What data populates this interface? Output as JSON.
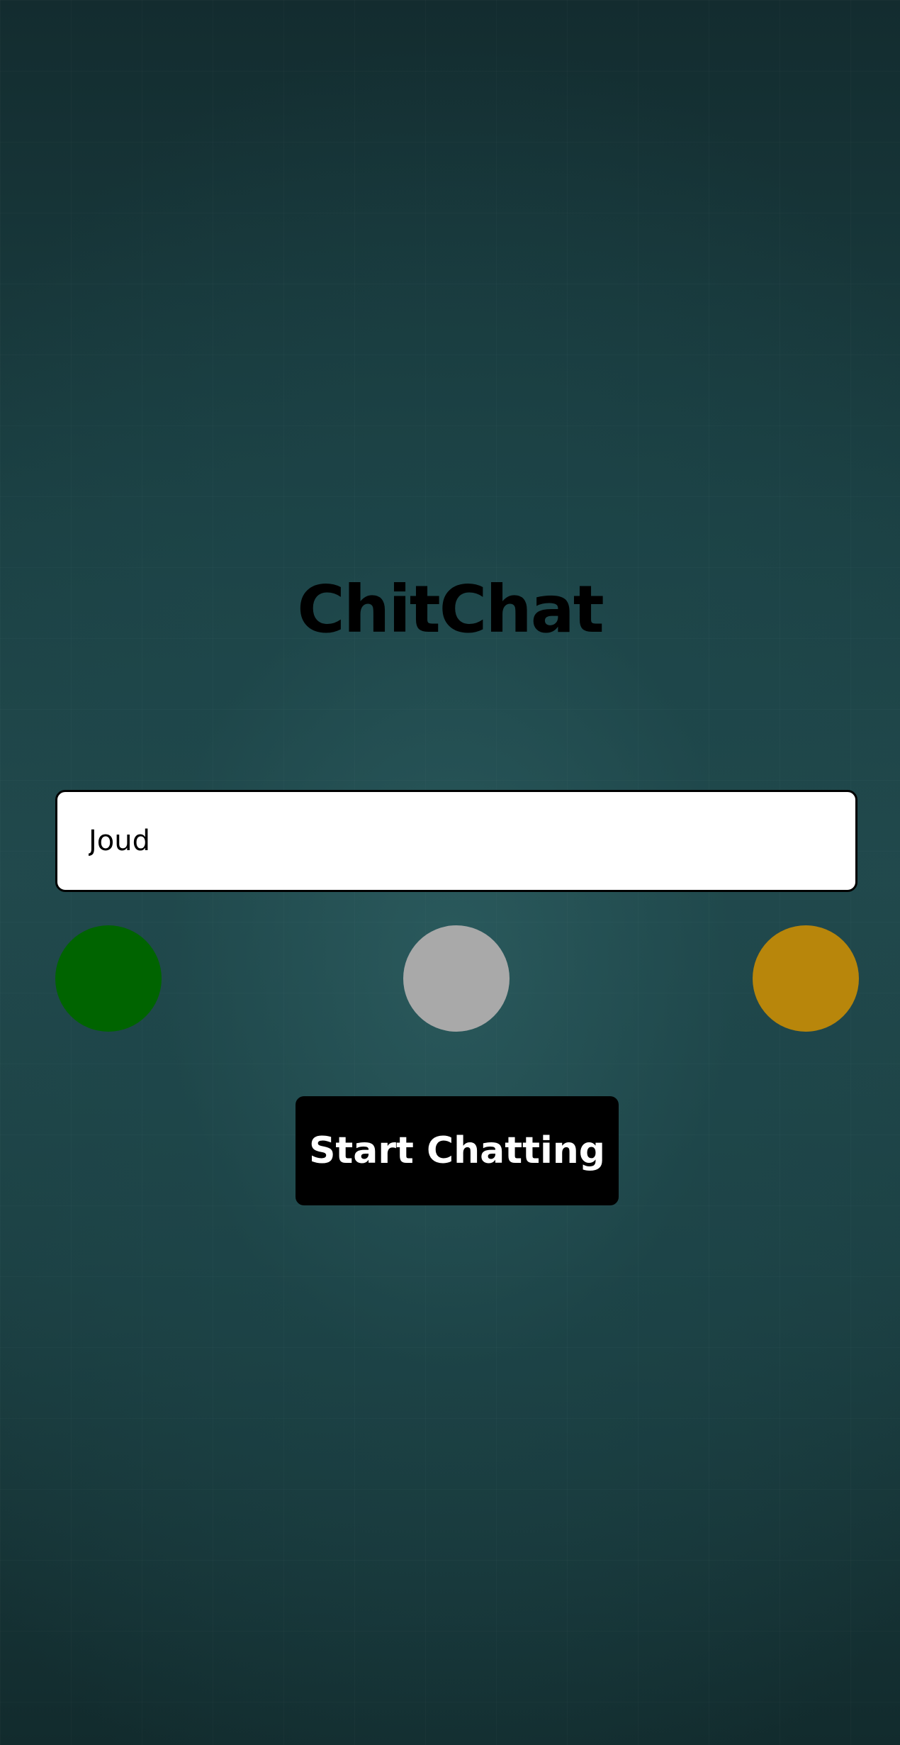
{
  "app": {
    "title": "ChitChat"
  },
  "name_field": {
    "value": "Joud",
    "placeholder": ""
  },
  "color_options": [
    {
      "name": "green",
      "color": "#006400"
    },
    {
      "name": "gray",
      "color": "#a9a9a9"
    },
    {
      "name": "gold",
      "color": "#b8860b"
    }
  ],
  "start_button": {
    "label": "Start Chatting"
  },
  "colors": {
    "background": "#1e4548",
    "button_bg": "#000000",
    "button_text": "#ffffff",
    "title_text": "#000000"
  }
}
